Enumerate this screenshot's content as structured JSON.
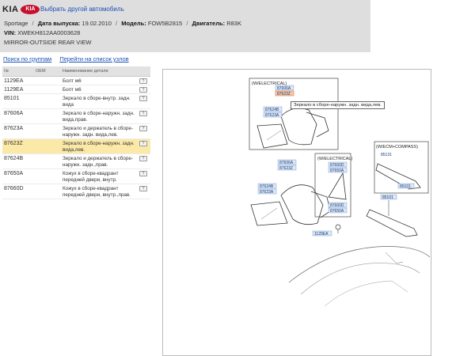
{
  "header": {
    "brand_text": "KIA",
    "brand_oval": "KIA",
    "change_car": "Выбрать другой автомобиль",
    "model_name": "Sportage",
    "release_label": "Дата выпуска:",
    "release_value": "19.02.2010",
    "model_label": "Модель:",
    "model_value": "FOW5B2815",
    "engine_label": "Двигатель:",
    "engine_value": "R83K",
    "vin_label": "VIN:",
    "vin_value": "XWEKH812AA0003628",
    "section_title": "MIRROR-OUTSIDE REAR VIEW"
  },
  "links": {
    "search_groups": "Поиск по группам",
    "go_to_nodes": "Перейти на список узлов"
  },
  "table": {
    "columns": [
      "№",
      "OEM",
      "Наименование детали"
    ],
    "rows": [
      {
        "code": "1129EA",
        "oem": "",
        "name": "Болт м6"
      },
      {
        "code": "1129EA",
        "oem": "",
        "name": "Болт м6"
      },
      {
        "code": "85101",
        "oem": "",
        "name": "Зеркало в сборе-внутр. задн. вида"
      },
      {
        "code": "87606A",
        "oem": "",
        "name": "Зеркало в сборе-наружн. задн. вида,прав."
      },
      {
        "code": "87623A",
        "oem": "",
        "name": "Зеркало и держатель в сборе-наружн. задн. вида,лев."
      },
      {
        "code": "87623Z",
        "oem": "",
        "name": "Зеркало в сборе-наружн. задн. вида,лев."
      },
      {
        "code": "87624B",
        "oem": "",
        "name": "Зеркало и держатель в сборе-наружн. задн.,прав."
      },
      {
        "code": "87650A",
        "oem": "",
        "name": "Кожух в сборе-квадрант передней двери, внутр."
      },
      {
        "code": "87660D",
        "oem": "",
        "name": "Кожух в сборе-квадрант передней двери, внутр.,прав."
      }
    ]
  },
  "diagram": {
    "tooltip": "Зеркало в сборе-наружн. задн. вида,лев.",
    "box_electrical_1": "(W/ELECTRICAL)",
    "box_electrical_2": "(W/ELECTRICAL)",
    "box_ecm": "(W/ECM+COMPASS)",
    "labels": {
      "l87606a_top": "87606A",
      "l87623z_top": "87623Z",
      "l87624b_top": "87624B",
      "l87623a_top": "87623A",
      "l87606a_mid": "87606A",
      "l87623z_mid": "87623Z",
      "l87624b_mid": "87624B",
      "l87623a_mid": "87623A",
      "l87660d_top": "87660D",
      "l87650a_top": "87650A",
      "l87660d_bot": "87660D",
      "l87650a_bot": "87650A",
      "l1129ea": "1129EA",
      "l85131": "85131",
      "l85101_a": "85101",
      "l85101_b": "85101"
    }
  },
  "colors": {
    "header_bg": "#dedede",
    "link": "#1a4fb5",
    "selected_row": "#fbe9a8",
    "brand_red": "#c8102e"
  }
}
